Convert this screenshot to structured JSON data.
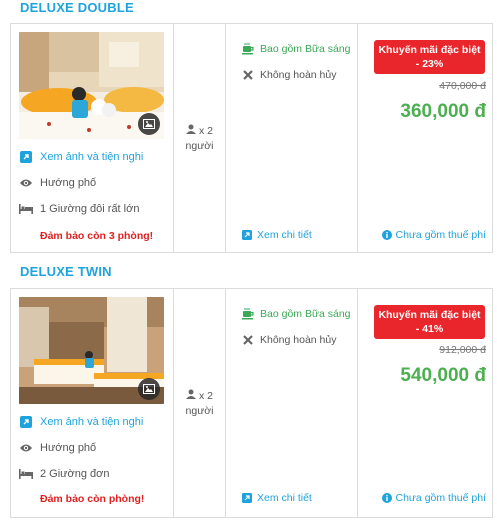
{
  "rooms": [
    {
      "title": "DELUXE DOUBLE",
      "gallery_link": "Xem ảnh và tiện nghi",
      "view": "Hướng phố",
      "bed": "1 Giường đôi rất lớn",
      "availability": "Đảm bảo còn 3 phòng!",
      "guests_count": "x 2",
      "guests_unit": "người",
      "breakfast": "Bao gồm Bữa sáng",
      "refund": "Không hoàn hủy",
      "details_link": "Xem chi tiết",
      "promo": "Khuyến mãi đặc biệt - 23%",
      "old_price": "470,000 đ",
      "price": "360,000 đ",
      "tax_note": "Chưa gồm thuế phí"
    },
    {
      "title": "DELUXE TWIN",
      "gallery_link": "Xem ảnh và tiện nghi",
      "view": "Hướng phố",
      "bed": "2 Giường đơn",
      "availability": "Đảm bảo còn phòng!",
      "guests_count": "x 2",
      "guests_unit": "người",
      "breakfast": "Bao gồm Bữa sáng",
      "refund": "Không hoàn hủy",
      "details_link": "Xem chi tiết",
      "promo": "Khuyến mãi đặc biệt - 41%",
      "old_price": "912,000 đ",
      "price": "540,000 đ",
      "tax_note": "Chưa gồm thuế phí"
    }
  ],
  "icons": {
    "gallery": "external-link-icon",
    "view": "eye-icon",
    "bed": "bed-icon",
    "guests": "user-icon",
    "breakfast": "coffee-cup-icon",
    "refund": "x-mark-icon",
    "details": "external-link-icon",
    "tax": "info-circle-icon",
    "photo": "image-icon"
  },
  "colors": {
    "title": "#1fa3dd",
    "link": "#1fa3dd",
    "warn": "#e02020",
    "promo_bg": "#e8262b",
    "price": "#4caf50",
    "breakfast": "#3aa856"
  }
}
